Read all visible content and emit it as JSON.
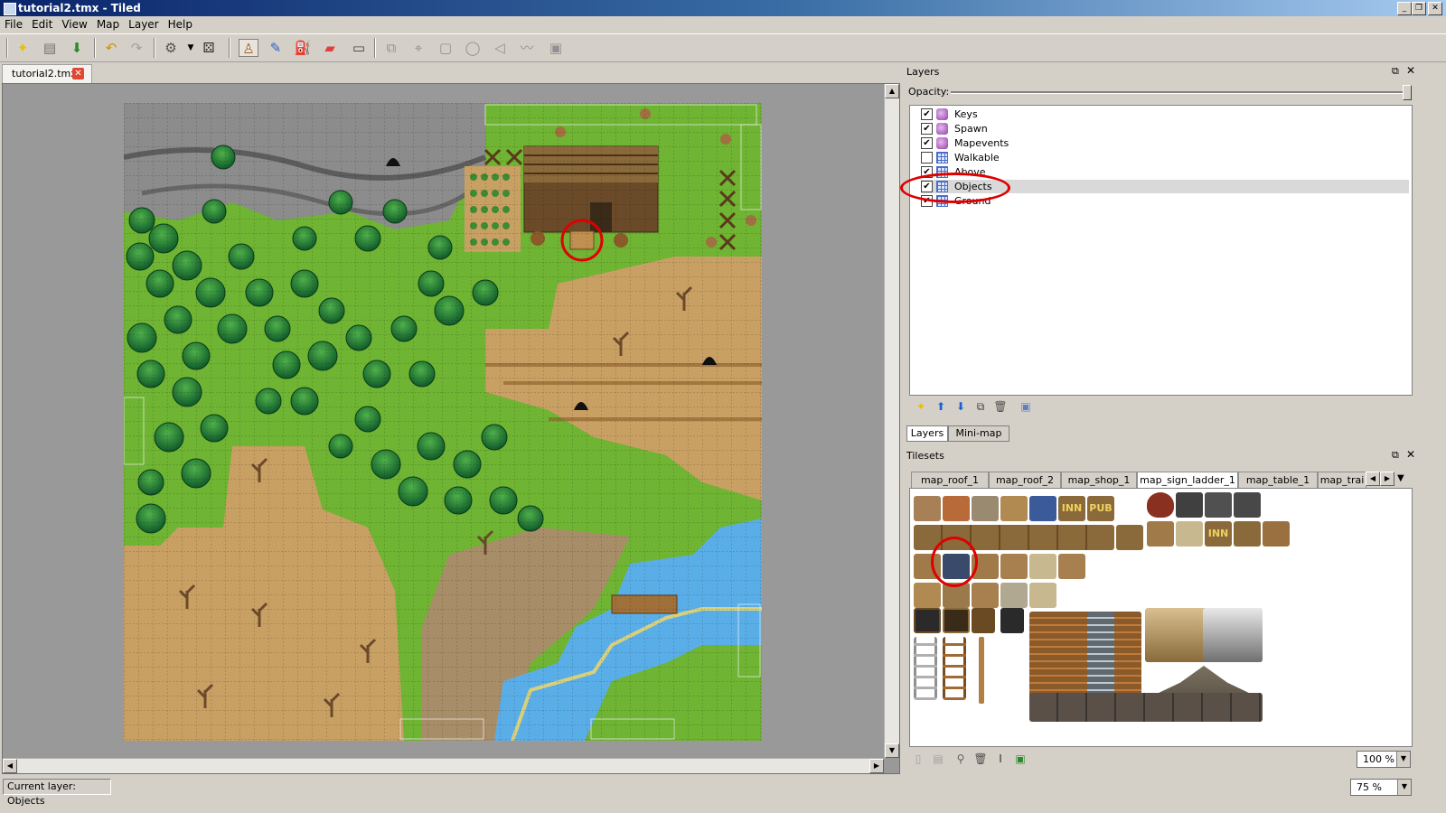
{
  "window": {
    "title": "tutorial2.tmx - Tiled"
  },
  "menu": [
    "File",
    "Edit",
    "View",
    "Map",
    "Layer",
    "Help"
  ],
  "toolbar": {
    "icons": [
      "new-icon",
      "open-icon",
      "save-icon",
      "undo-icon",
      "redo-icon",
      "random-icon",
      "dice-icon",
      "stamp-brush-icon",
      "terrain-brush-icon",
      "bucket-fill-icon",
      "eraser-icon",
      "rect-select-icon",
      "select-objects-icon",
      "edit-polygons-icon",
      "insert-rectangle-icon",
      "insert-ellipse-icon",
      "insert-polygon-icon",
      "insert-polyline-icon",
      "insert-tile-icon"
    ]
  },
  "document_tab": {
    "label": "tutorial2.tmx"
  },
  "layers_panel": {
    "title": "Layers",
    "opacity_label": "Opacity:",
    "opacity": 1.0,
    "layers": [
      {
        "name": "Keys",
        "kind": "object",
        "visible": true,
        "selected": false
      },
      {
        "name": "Spawn",
        "kind": "object",
        "visible": true,
        "selected": false
      },
      {
        "name": "Mapevents",
        "kind": "object",
        "visible": true,
        "selected": false
      },
      {
        "name": "Walkable",
        "kind": "tile",
        "visible": false,
        "selected": false
      },
      {
        "name": "Above",
        "kind": "tile",
        "visible": true,
        "selected": false
      },
      {
        "name": "Objects",
        "kind": "tile",
        "visible": true,
        "selected": true
      },
      {
        "name": "Ground",
        "kind": "tile",
        "visible": true,
        "selected": false
      }
    ],
    "tabs": [
      "Layers",
      "Mini-map"
    ],
    "active_tab": "Layers"
  },
  "tilesets_panel": {
    "title": "Tilesets",
    "tabs": [
      "map_roof_1",
      "map_roof_2",
      "map_shop_1",
      "map_sign_ladder_1",
      "map_table_1",
      "map_trai"
    ],
    "active_tab": "map_sign_ladder_1",
    "sign_labels": [
      "INN",
      "PUB",
      "INN"
    ],
    "zoom": "100 %"
  },
  "statusbar": {
    "current_layer": "Current layer: Objects",
    "zoom": "75 %"
  },
  "colors": {
    "highlight_ring": "#e00000",
    "grass": "#6fb433",
    "dirt": "#c9a063",
    "water": "#5aaee8",
    "rock": "#8c8c8c"
  }
}
